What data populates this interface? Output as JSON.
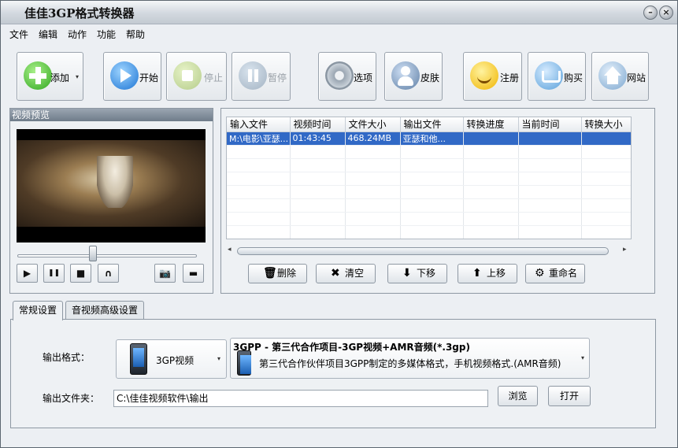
{
  "window": {
    "title": "佳佳3GP格式转换器",
    "minimize_glyph": "–",
    "close_glyph": "×"
  },
  "menu": [
    "文件",
    "编辑",
    "动作",
    "功能",
    "帮助"
  ],
  "toolbar": {
    "add": "添加",
    "start": "开始",
    "stop": "停止",
    "pause": "暂停",
    "options": "选项",
    "skin": "皮肤",
    "register": "注册",
    "buy": "购买",
    "website": "网站",
    "dropdown_glyph": "▾"
  },
  "preview": {
    "title": "视频预览",
    "progress": 0.42,
    "buttons": {
      "play": "▶",
      "pause": "❚❚",
      "stop": "■",
      "loop": "∩",
      "snapshot": "📷",
      "folder": "▬"
    }
  },
  "file_list": {
    "columns": [
      "输入文件",
      "视频时间",
      "文件大小",
      "输出文件",
      "转换进度",
      "当前时间",
      "转换大小"
    ],
    "rows": [
      [
        "M:\\电影\\亚瑟...",
        "01:43:45",
        "468.24MB",
        "亚瑟和他...",
        "",
        "",
        ""
      ]
    ],
    "empty_rows": 7,
    "scroll_left": "◂",
    "scroll_right": "▸"
  },
  "list_actions": {
    "delete": "删除",
    "clear": "清空",
    "move_down": "下移",
    "move_up": "上移",
    "rename": "重命名",
    "delete_icon": "🗑",
    "clear_icon": "✖",
    "down_icon": "⬇",
    "up_icon": "⬆",
    "rename_icon": "⚙"
  },
  "tabs": [
    "常规设置",
    "音视频高级设置"
  ],
  "settings": {
    "output_format_label": "输出格式：",
    "format_category": "3GP视频",
    "format_title": "3GPP - 第三代合作项目-3GP视频+AMR音频(*.3gp)",
    "format_desc": "第三代合作伙伴项目3GPP制定的多媒体格式，手机视频格式.(AMR音频)",
    "output_folder_label": "输出文件夹：",
    "output_folder": "C:\\佳佳视频软件\\输出",
    "browse": "浏览",
    "open": "打开"
  }
}
